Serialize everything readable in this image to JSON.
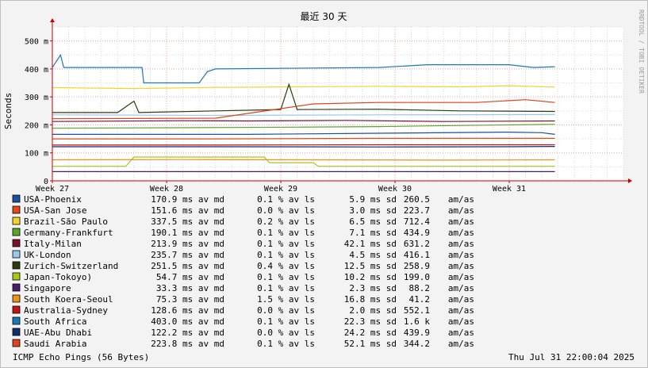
{
  "chart_data": {
    "type": "line",
    "title": "最近 30 天",
    "ylabel": "Seconds",
    "ylim": [
      0,
      0.55
    ],
    "yticks": [
      {
        "v": 0,
        "label": "0"
      },
      {
        "v": 0.1,
        "label": "100 m"
      },
      {
        "v": 0.2,
        "label": "200 m"
      },
      {
        "v": 0.3,
        "label": "300 m"
      },
      {
        "v": 0.4,
        "label": "400 m"
      },
      {
        "v": 0.5,
        "label": "500 m"
      }
    ],
    "xlim": [
      0,
      35
    ],
    "xticks": [
      {
        "v": 0,
        "label": "Week 27"
      },
      {
        "v": 7,
        "label": "Week 28"
      },
      {
        "v": 14,
        "label": "Week 29"
      },
      {
        "v": 21,
        "label": "Week 30"
      },
      {
        "v": 28,
        "label": "Week 31"
      }
    ],
    "side_label": "RRDTOOL / TOBI OETIKER",
    "series": [
      {
        "name": "USA-Phoenix",
        "color": "#1f4e9c",
        "points": [
          [
            0,
            0.166
          ],
          [
            12,
            0.166
          ],
          [
            20,
            0.17
          ],
          [
            28,
            0.174
          ],
          [
            30,
            0.172
          ],
          [
            30.8,
            0.166
          ]
        ],
        "stats": {
          "avg": "170.9 ms av md",
          "loss": "0.1 % av ls",
          "sd": "5.9 ms sd",
          "ratio": "260.5",
          "unit": "am/as"
        }
      },
      {
        "name": "USA-San Jose",
        "color": "#e24a1c",
        "points": [
          [
            0,
            0.15
          ],
          [
            10,
            0.15
          ],
          [
            20,
            0.152
          ],
          [
            30.8,
            0.152
          ]
        ],
        "stats": {
          "avg": "151.6 ms av md",
          "loss": "0.0 % av ls",
          "sd": "3.0 ms sd",
          "ratio": "223.7",
          "unit": "am/as"
        }
      },
      {
        "name": "Brazil-São Paulo",
        "color": "#f2d42c",
        "points": [
          [
            0,
            0.333
          ],
          [
            5,
            0.33
          ],
          [
            10,
            0.334
          ],
          [
            15,
            0.336
          ],
          [
            20,
            0.338
          ],
          [
            25,
            0.336
          ],
          [
            28,
            0.34
          ],
          [
            30.8,
            0.335
          ]
        ],
        "stats": {
          "avg": "337.5 ms av md",
          "loss": "0.2 % av ls",
          "sd": "6.5 ms sd",
          "ratio": "712.4",
          "unit": "am/as"
        }
      },
      {
        "name": "Germany-Frankfurt",
        "color": "#5aa82a",
        "points": [
          [
            0,
            0.188
          ],
          [
            8,
            0.19
          ],
          [
            15,
            0.192
          ],
          [
            20,
            0.194
          ],
          [
            25,
            0.198
          ],
          [
            28,
            0.2
          ],
          [
            30.8,
            0.202
          ]
        ],
        "stats": {
          "avg": "190.1 ms av md",
          "loss": "0.1 % av ls",
          "sd": "7.1 ms sd",
          "ratio": "434.9",
          "unit": "am/as"
        }
      },
      {
        "name": "Italy-Milan",
        "color": "#7a1030",
        "points": [
          [
            0,
            0.212
          ],
          [
            8,
            0.215
          ],
          [
            12,
            0.214
          ],
          [
            18,
            0.216
          ],
          [
            24,
            0.212
          ],
          [
            30.8,
            0.214
          ]
        ],
        "stats": {
          "avg": "213.9 ms av md",
          "loss": "0.1 % av ls",
          "sd": "42.1 ms sd",
          "ratio": "631.2",
          "unit": "am/as"
        }
      },
      {
        "name": "UK-London",
        "color": "#9bc9ec",
        "points": [
          [
            0,
            0.236
          ],
          [
            10,
            0.234
          ],
          [
            20,
            0.236
          ],
          [
            30.8,
            0.237
          ]
        ],
        "stats": {
          "avg": "235.7 ms av md",
          "loss": "0.1 % av ls",
          "sd": "4.5 ms sd",
          "ratio": "416.1",
          "unit": "am/as"
        }
      },
      {
        "name": "Zurich-Switzerland",
        "color": "#2a3a10",
        "points": [
          [
            0,
            0.244
          ],
          [
            4,
            0.244
          ],
          [
            5,
            0.285
          ],
          [
            5.3,
            0.244
          ],
          [
            10,
            0.25
          ],
          [
            14,
            0.255
          ],
          [
            14.5,
            0.345
          ],
          [
            15,
            0.255
          ],
          [
            20,
            0.256
          ],
          [
            25,
            0.25
          ],
          [
            30.8,
            0.248
          ]
        ],
        "stats": {
          "avg": "251.5 ms av md",
          "loss": "0.4 % av ls",
          "sd": "12.5 ms sd",
          "ratio": "258.9",
          "unit": "am/as"
        }
      },
      {
        "name": "Japan-Tokoyo)",
        "color": "#a8c81a",
        "points": [
          [
            0,
            0.052
          ],
          [
            4.5,
            0.052
          ],
          [
            5,
            0.085
          ],
          [
            13,
            0.085
          ],
          [
            13.3,
            0.065
          ],
          [
            16,
            0.065
          ],
          [
            16.3,
            0.052
          ],
          [
            30.8,
            0.052
          ]
        ],
        "stats": {
          "avg": "54.7 ms av md",
          "loss": "0.1 % av ls",
          "sd": "10.2 ms sd",
          "ratio": "199.0",
          "unit": "am/as"
        }
      },
      {
        "name": "Singapore",
        "color": "#4a1a6e",
        "points": [
          [
            0,
            0.033
          ],
          [
            10,
            0.033
          ],
          [
            20,
            0.033
          ],
          [
            30.8,
            0.033
          ]
        ],
        "stats": {
          "avg": "33.3 ms av md",
          "loss": "0.1 % av ls",
          "sd": "2.3 ms sd",
          "ratio": "88.2",
          "unit": "am/as"
        }
      },
      {
        "name": "South Koera-Seoul",
        "color": "#f0901c",
        "points": [
          [
            0,
            0.075
          ],
          [
            8,
            0.076
          ],
          [
            16,
            0.075
          ],
          [
            24,
            0.074
          ],
          [
            30.8,
            0.075
          ]
        ],
        "stats": {
          "avg": "75.3 ms av md",
          "loss": "1.5 % av ls",
          "sd": "16.8 ms sd",
          "ratio": "41.2",
          "unit": "am/as"
        }
      },
      {
        "name": "Australia-Sydney",
        "color": "#c41414",
        "points": [
          [
            0,
            0.128
          ],
          [
            10,
            0.128
          ],
          [
            20,
            0.129
          ],
          [
            30.8,
            0.129
          ]
        ],
        "stats": {
          "avg": "128.6 ms av md",
          "loss": "0.0 % av ls",
          "sd": "2.0 ms sd",
          "ratio": "552.1",
          "unit": "am/as"
        }
      },
      {
        "name": "South Africa",
        "color": "#1a7ab8",
        "points": [
          [
            0,
            0.405
          ],
          [
            0.5,
            0.45
          ],
          [
            0.7,
            0.405
          ],
          [
            5.5,
            0.405
          ],
          [
            5.6,
            0.35
          ],
          [
            9,
            0.35
          ],
          [
            9.5,
            0.39
          ],
          [
            10,
            0.4
          ],
          [
            20,
            0.405
          ],
          [
            23,
            0.415
          ],
          [
            28,
            0.415
          ],
          [
            29.5,
            0.405
          ],
          [
            30.8,
            0.408
          ]
        ],
        "stats": {
          "avg": "403.0 ms av md",
          "loss": "0.1 % av ls",
          "sd": "22.3 ms sd",
          "ratio": "1.6 k",
          "unit": "am/as"
        }
      },
      {
        "name": "UAE-Abu Dhabi",
        "color": "#0f2f6e",
        "points": [
          [
            0,
            0.122
          ],
          [
            10,
            0.122
          ],
          [
            20,
            0.121
          ],
          [
            28,
            0.122
          ],
          [
            30.8,
            0.123
          ]
        ],
        "stats": {
          "avg": "122.2 ms av md",
          "loss": "0.0 % av ls",
          "sd": "24.2 ms sd",
          "ratio": "439.9",
          "unit": "am/as"
        }
      },
      {
        "name": "Saudi Arabia",
        "color": "#e0421a",
        "points": [
          [
            0,
            0.222
          ],
          [
            10,
            0.224
          ],
          [
            16,
            0.275
          ],
          [
            20,
            0.28
          ],
          [
            26,
            0.28
          ],
          [
            29,
            0.29
          ],
          [
            30.8,
            0.28
          ]
        ],
        "stats": {
          "avg": "223.8 ms av md",
          "loss": "0.1 % av ls",
          "sd": "52.1 ms sd",
          "ratio": "344.2",
          "unit": "am/as"
        }
      }
    ],
    "footer_left": "ICMP Echo Pings (56 Bytes)",
    "footer_right": "Thu Jul 31 22:00:04 2025"
  }
}
